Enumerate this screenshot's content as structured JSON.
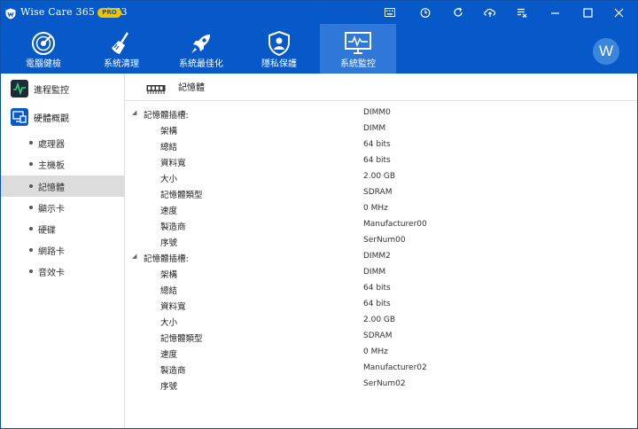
{
  "app": {
    "title": "Wise Care 365 - 4.53",
    "badge": "PRO",
    "avatar_letter": "W",
    "brand_color": "#0759c9",
    "active_tool_color": "#2f78d8"
  },
  "titlebar_icons": [
    "keyboard-icon",
    "timer-icon",
    "refresh-icon",
    "cloud-upload-icon",
    "checklist-icon",
    "minimize-icon",
    "maximize-icon",
    "close-icon"
  ],
  "toolbar": {
    "items": [
      {
        "label": "電腦健檢",
        "icon": "radar-icon"
      },
      {
        "label": "系統清理",
        "icon": "broom-icon"
      },
      {
        "label": "系統最佳化",
        "icon": "rocket-icon"
      },
      {
        "label": "隱私保護",
        "icon": "shield-user-icon"
      },
      {
        "label": "系統監控",
        "icon": "monitor-pulse-icon"
      }
    ],
    "active_index": 4
  },
  "sidebar": {
    "heads": [
      {
        "label": "進程監控",
        "icon": "pulse-icon"
      },
      {
        "label": "硬體概觀",
        "icon": "hardware-icon"
      }
    ],
    "items": [
      {
        "label": "處理器"
      },
      {
        "label": "主機板"
      },
      {
        "label": "記憶體"
      },
      {
        "label": "顯示卡"
      },
      {
        "label": "硬碟"
      },
      {
        "label": "網路卡"
      },
      {
        "label": "音效卡"
      }
    ],
    "active_item": 2
  },
  "main": {
    "title": "記憶體",
    "icon": "ram-chip-icon",
    "slots": [
      {
        "label": "記憶體插槽:",
        "value": "DIMM0",
        "props": [
          {
            "label": "架構",
            "value": "DIMM"
          },
          {
            "label": "總結",
            "value": "64 bits"
          },
          {
            "label": "資料寬",
            "value": "64 bits"
          },
          {
            "label": "大小",
            "value": "2.00 GB"
          },
          {
            "label": "記憶體類型",
            "value": "SDRAM"
          },
          {
            "label": "速度",
            "value": "0 MHz"
          },
          {
            "label": "製造商",
            "value": "Manufacturer00"
          },
          {
            "label": "序號",
            "value": "SerNum00"
          }
        ]
      },
      {
        "label": "記憶體插槽:",
        "value": "DIMM2",
        "props": [
          {
            "label": "架構",
            "value": "DIMM"
          },
          {
            "label": "總結",
            "value": "64 bits"
          },
          {
            "label": "資料寬",
            "value": "64 bits"
          },
          {
            "label": "大小",
            "value": "2.00 GB"
          },
          {
            "label": "記憶體類型",
            "value": "SDRAM"
          },
          {
            "label": "速度",
            "value": "0 MHz"
          },
          {
            "label": "製造商",
            "value": "Manufacturer02"
          },
          {
            "label": "序號",
            "value": "SerNum02"
          }
        ]
      }
    ]
  }
}
